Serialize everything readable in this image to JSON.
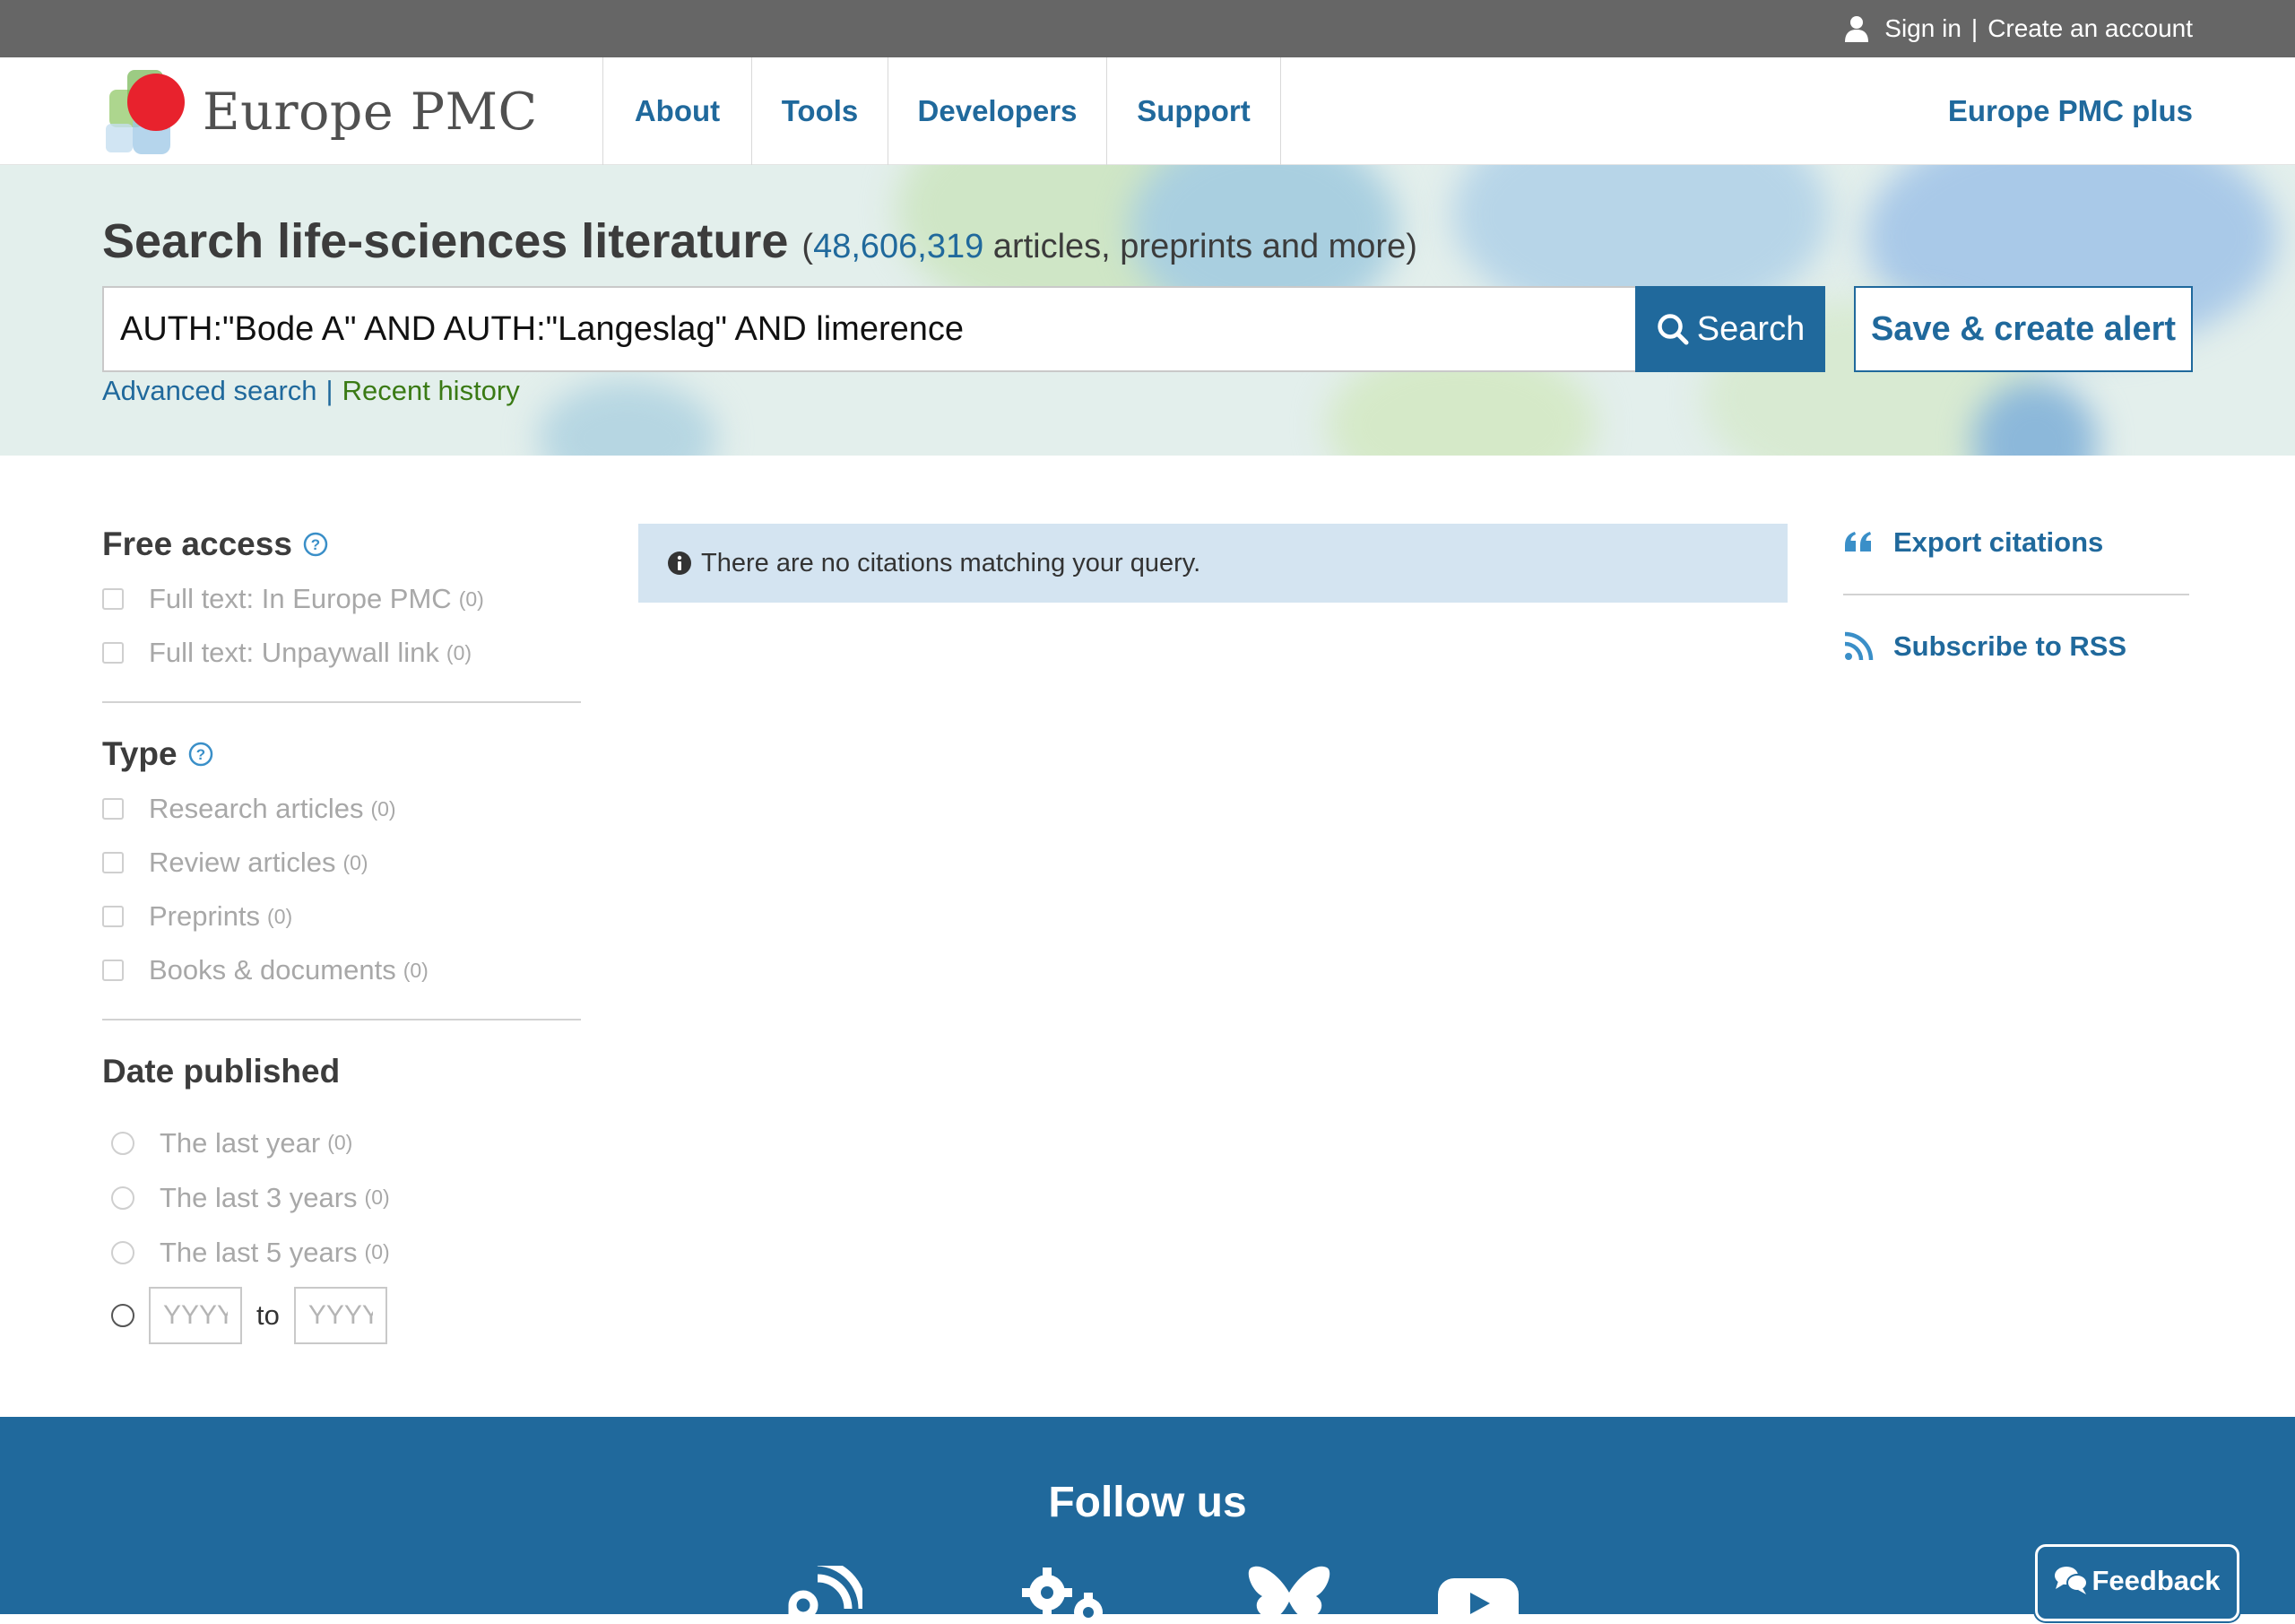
{
  "topbar": {
    "sign_in": "Sign in",
    "separator": "|",
    "create_account": "Create an account"
  },
  "header": {
    "logo_text": "Europe PMC",
    "nav": [
      "About",
      "Tools",
      "Developers",
      "Support"
    ],
    "plus_link": "Europe PMC plus"
  },
  "search": {
    "heading": "Search life-sciences literature",
    "count_open": "(",
    "count": "48,606,319",
    "count_suffix": " articles, preprints and more)",
    "query": "AUTH:\"Bode A\" AND AUTH:\"Langeslag\" AND limerence",
    "search_button": "Search",
    "alert_button": "Save & create alert",
    "advanced_link": "Advanced search",
    "link_separator": "|",
    "recent_link": "Recent history"
  },
  "facets": {
    "free_access": {
      "title": "Free access",
      "items": [
        {
          "label": "Full text: In Europe PMC",
          "count": "(0)"
        },
        {
          "label": "Full text: Unpaywall link",
          "count": "(0)"
        }
      ]
    },
    "type": {
      "title": "Type",
      "items": [
        {
          "label": "Research articles",
          "count": "(0)"
        },
        {
          "label": "Review articles",
          "count": "(0)"
        },
        {
          "label": "Preprints",
          "count": "(0)"
        },
        {
          "label": "Books & documents",
          "count": "(0)"
        }
      ]
    },
    "date": {
      "title": "Date published",
      "items": [
        {
          "label": "The last year",
          "count": "(0)"
        },
        {
          "label": "The last 3 years",
          "count": "(0)"
        },
        {
          "label": "The last 5 years",
          "count": "(0)"
        }
      ],
      "from_placeholder": "YYYY",
      "to_label": "to",
      "to_placeholder": "YYYY"
    }
  },
  "results": {
    "message": "There are no citations matching your query."
  },
  "actions": {
    "export": "Export citations",
    "rss": "Subscribe to RSS"
  },
  "footer": {
    "follow_title": "Follow us",
    "social_icons": [
      "blog-icon",
      "gear-icon",
      "bluesky-icon",
      "youtube-icon"
    ]
  },
  "feedback": {
    "label": "Feedback"
  },
  "colors": {
    "brand_blue": "#20699c",
    "topbar_gray": "#666666",
    "link_green": "#3a7a14",
    "notice_bg": "#d4e4f1"
  }
}
